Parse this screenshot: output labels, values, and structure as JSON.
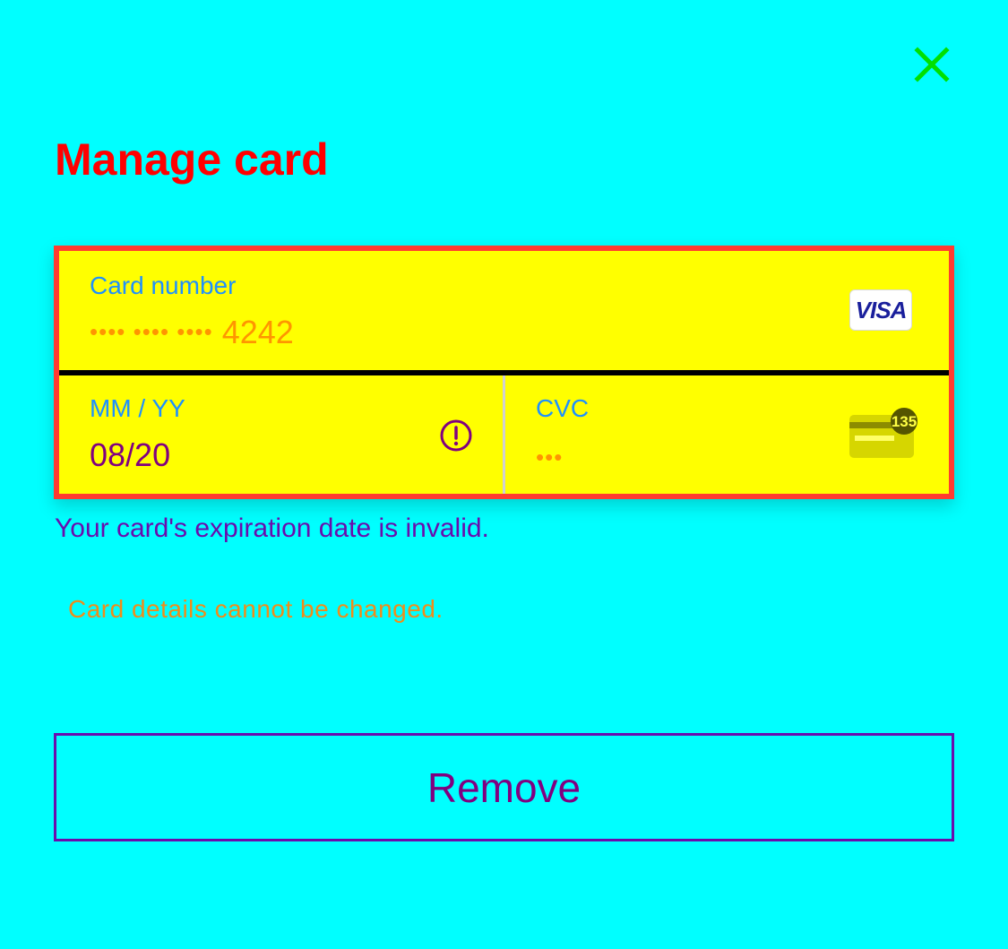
{
  "header": {
    "title": "Manage card",
    "close_icon": "close-icon"
  },
  "card_form": {
    "card_number": {
      "label": "Card number",
      "masked_groups": "•••• •••• ••••",
      "last4": "4242",
      "brand": "VISA"
    },
    "expiry": {
      "label": "MM / YY",
      "value": "08/20",
      "status_icon": "error-icon"
    },
    "cvc": {
      "label": "CVC",
      "value": "•••",
      "hint_icon": "card-back-cvc-icon",
      "hint_code": "135"
    }
  },
  "messages": {
    "error": "Your card's expiration date is invalid.",
    "notice": "Card details cannot be changed."
  },
  "actions": {
    "remove_label": "Remove"
  },
  "colors": {
    "background": "#00ffff",
    "title": "#ff0000",
    "field_background": "#ffff00",
    "field_border": "#ff3b30",
    "label": "#1e90ff",
    "masked_text": "#ff9500",
    "expiry_text": "#800080",
    "error_text": "#6a0dad",
    "notice_text": "#f08c1a",
    "close_icon": "#00e000",
    "button_border": "#6a0dad"
  }
}
